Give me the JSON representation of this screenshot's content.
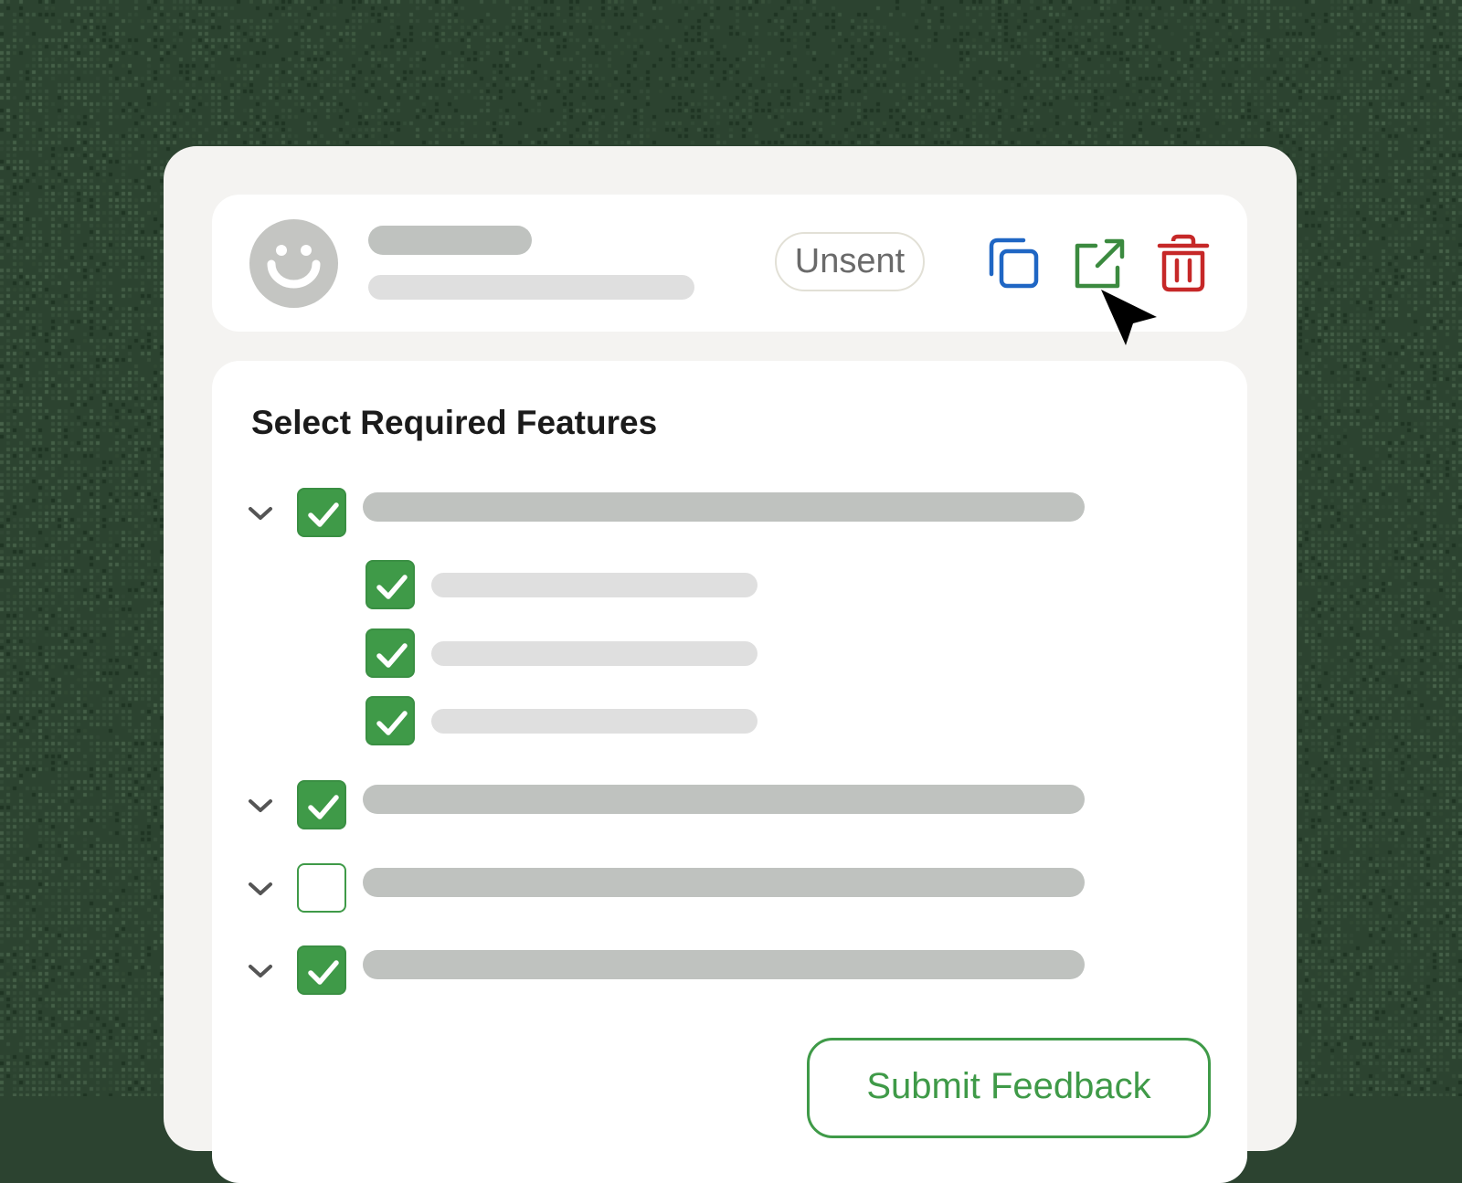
{
  "header": {
    "status_badge": "Unsent",
    "actions": {
      "copy_icon": "copy-icon",
      "open_icon": "external-link-icon",
      "delete_icon": "trash-icon"
    }
  },
  "features": {
    "title": "Select Required Features",
    "groups": [
      {
        "checked": true,
        "expanded": true,
        "children": [
          {
            "checked": true
          },
          {
            "checked": true
          },
          {
            "checked": true
          }
        ]
      },
      {
        "checked": true,
        "expanded": false,
        "children": []
      },
      {
        "checked": false,
        "expanded": false,
        "children": []
      },
      {
        "checked": true,
        "expanded": false,
        "children": []
      }
    ]
  },
  "footer": {
    "submit_label": "Submit Feedback"
  },
  "colors": {
    "background": "#2c4330",
    "accent_green": "#3f9a48",
    "copy_blue": "#1f66c4",
    "delete_red": "#c62828",
    "placeholder_dark": "#bfc2bf",
    "placeholder_light": "#dfdfdf"
  }
}
